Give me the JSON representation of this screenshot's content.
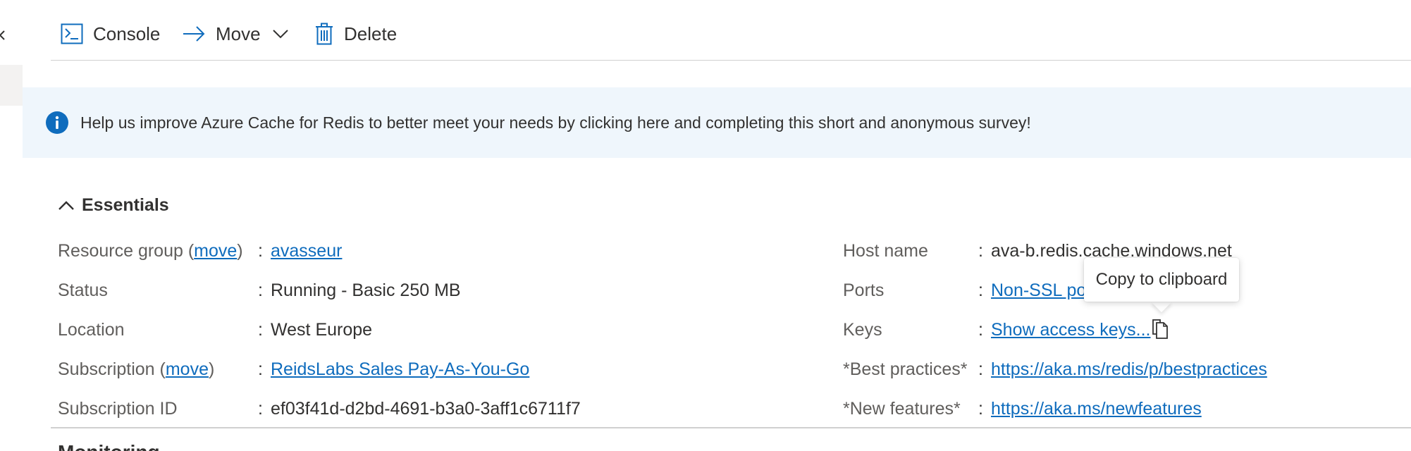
{
  "toolbar": {
    "console_label": "Console",
    "move_label": "Move",
    "delete_label": "Delete"
  },
  "banner": {
    "text": "Help us improve Azure Cache for Redis to better meet your needs by clicking here and completing this short and anonymous survey!"
  },
  "essentials": {
    "title": "Essentials",
    "left": [
      {
        "label_prefix": "Resource group (",
        "label_link": "move",
        "label_suffix": ")",
        "value": "avasseur",
        "value_is_link": true
      },
      {
        "label": "Status",
        "value": "Running - Basic 250 MB"
      },
      {
        "label": "Location",
        "value": "West Europe"
      },
      {
        "label_prefix": "Subscription (",
        "label_link": "move",
        "label_suffix": ")",
        "value": "ReidsLabs Sales Pay-As-You-Go",
        "value_is_link": true
      },
      {
        "label": "Subscription ID",
        "value": "ef03f41d-d2bd-4691-b3a0-3aff1c6711f7"
      }
    ],
    "right": [
      {
        "label": "Host name",
        "value": "ava-b.redis.cache.windows.net"
      },
      {
        "label": "Ports",
        "value": "Non-SSL po",
        "value_is_link": true
      },
      {
        "label": "Keys",
        "value": "Show access keys...",
        "value_is_link": true
      },
      {
        "label": "*Best practices*",
        "value": "https://aka.ms/redis/p/bestpractices",
        "value_is_link": true
      },
      {
        "label": "*New features*",
        "value": "https://aka.ms/newfeatures",
        "value_is_link": true
      }
    ],
    "colon": ":"
  },
  "tooltip": {
    "text": "Copy to clipboard"
  },
  "next_section": {
    "heading_partial": "Monitoring"
  },
  "icons": {
    "console": "console-icon",
    "move": "arrow-right-icon",
    "delete": "trash-icon",
    "info": "info-icon",
    "copy": "copy-icon"
  },
  "colors": {
    "accent": "#0f6cbd",
    "banner_bg": "#eff6fc",
    "label": "#605e5c",
    "text": "#323130"
  }
}
